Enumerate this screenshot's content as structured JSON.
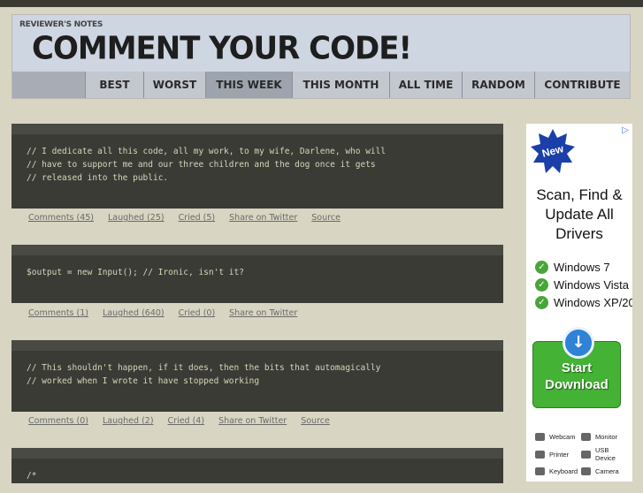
{
  "header": {
    "kicker": "REVIEWER'S NOTES",
    "title": "COMMENT YOUR CODE!"
  },
  "nav": {
    "items": [
      {
        "label": "BEST"
      },
      {
        "label": "WORST"
      },
      {
        "label": "THIS WEEK"
      },
      {
        "label": "THIS MONTH"
      },
      {
        "label": "ALL TIME"
      },
      {
        "label": "RANDOM"
      },
      {
        "label": "CONTRIBUTE"
      }
    ]
  },
  "snippets": [
    {
      "code": "// I dedicate all this code, all my work, to my wife, Darlene, who will\n// have to support me and our three children and the dog once it gets\n// released into the public.",
      "actions": [
        "Comments (45)",
        "Laughed (25)",
        "Cried (5)",
        "Share on Twitter",
        "Source"
      ]
    },
    {
      "code": "$output = new Input(); // Ironic, isn't it?",
      "actions": [
        "Comments (1)",
        "Laughed (640)",
        "Cried (0)",
        "Share on Twitter"
      ]
    },
    {
      "code": "// This shouldn't happen, if it does, then the bits that automagically\n// worked when I wrote it have stopped working",
      "actions": [
        "Comments (0)",
        "Laughed (2)",
        "Cried (4)",
        "Share on Twitter",
        "Source"
      ]
    },
    {
      "code": "/*",
      "actions": []
    }
  ],
  "ad": {
    "badge": "New",
    "title": "Scan, Find & Update All Drivers",
    "os_list": [
      "Windows 7",
      "Windows Vista",
      "Windows XP/20"
    ],
    "button": "Start Download",
    "devices": [
      "Webcam",
      "Monitor",
      "Printer",
      "USB Device",
      "Keyboard",
      "Camera"
    ],
    "colors": {
      "button": "#44b234",
      "badge": "#1b3fa8",
      "check": "#49a53a"
    }
  }
}
